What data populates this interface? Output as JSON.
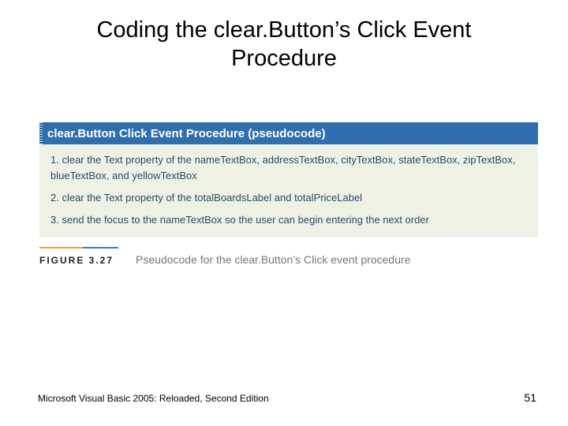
{
  "title": "Coding the clear.Button’s Click Event Procedure",
  "figure": {
    "header": "clear.Button Click Event Procedure (pseudocode)",
    "steps": [
      "1. clear the Text property of the nameTextBox, addressTextBox, cityTextBox, stateTextBox, zipTextBox, blueTextBox, and yellowTextBox",
      "2. clear the Text property of the totalBoardsLabel and totalPriceLabel",
      "3. send the focus to the nameTextBox so the user can begin entering the next order"
    ],
    "caption_label": "FIGURE 3.27",
    "caption_text": "Pseudocode for the clear.Button’s Click event procedure"
  },
  "footer": {
    "source": "Microsoft Visual Basic 2005: Reloaded, Second Edition",
    "page": "51"
  }
}
